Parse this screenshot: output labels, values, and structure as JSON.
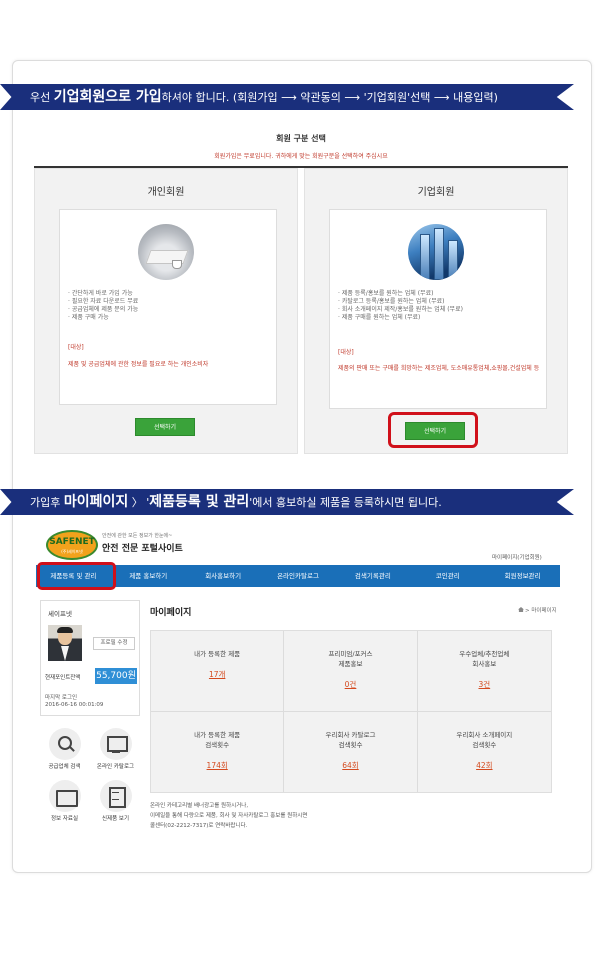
{
  "banner1": {
    "prefix": "우선 ",
    "bold": "기업회원으로 가입",
    "suffix": "하셔야 합니다. (회원가입 ⟶ 약관동의 ⟶ '기업회원'선택 ⟶ 내용입력)"
  },
  "selection": {
    "title": "회원 구분 선택",
    "subtitle": "회원가입은 무료입니다. 귀하에게 맞는 회원구분을 선택하여 주십시요"
  },
  "personal": {
    "title": "개인회원",
    "features": [
      "· 간단하게 바로 가입 가능",
      "· 필요한 자료 다운로드 무료",
      "· 공급업체에 제품 문의 가능",
      "· 제품 구매 가능"
    ],
    "target_label": "[대상]",
    "target_text": "제품 및 공급업체에 관한 정보를 필요로 하는 개인소비자",
    "button": "선택하기"
  },
  "corporate": {
    "title": "기업회원",
    "features": [
      "· 제품 등록/홍보를 원하는 업체 (무료)",
      "· 카탈로그 등록/홍보를 원하는 업체 (무료)",
      "· 회사 소개페이지 제작/홍보를 원하는 업체 (무료)",
      "· 제품 구매를 원하는 업체 (무료)"
    ],
    "target_label": "[대상]",
    "target_text": "제품의 판매 또는 구매를 희망하는 제조업체, 도소매유통업체,쇼핑몰,건설업체 등",
    "button": "선택하기"
  },
  "banner2": {
    "prefix": "가입후 ",
    "bold1": "마이페이지",
    "mid": " 〉 '",
    "bold2": "제품등록 및 관리",
    "suffix": "'에서 홍보하실 제품을 등록하시면 됩니다."
  },
  "logo": {
    "name": "SAFENET",
    "sub": "(주)세이프넷"
  },
  "header": {
    "tagline": "안전에 관한 모든 정보가 한눈에~",
    "portal": "안전 전문 포털사이트",
    "mypage_link": "마이페이지(기업회원)"
  },
  "nav": [
    "제품등록 및 관리",
    "제품 홍보하기",
    "회사홍보하기",
    "온라인카탈로그",
    "검색기록관리",
    "코인관리",
    "회원정보관리"
  ],
  "profile": {
    "name": "세이프넷",
    "edit": "프로필 수정",
    "points_label": "현재포인트잔액",
    "points": "55,700원",
    "last_login_label": "마지막 로그인",
    "last_login": "2016-06-16 00:01:09"
  },
  "quick_menu": [
    {
      "label": "공급업체 검색",
      "icon": "search-icon"
    },
    {
      "label": "온라인 카탈로그",
      "icon": "monitor-icon"
    },
    {
      "label": "정보 자료실",
      "icon": "folder-icon"
    },
    {
      "label": "신제품 보기",
      "icon": "document-icon"
    }
  ],
  "main": {
    "title": "마이페이지",
    "breadcrumb": "> 마이페이지"
  },
  "stats": [
    {
      "line1": "내가 등록한 제품",
      "line2": "",
      "value": "17개"
    },
    {
      "line1": "프리미엄/포커스",
      "line2": "제품홍보",
      "value": "0건"
    },
    {
      "line1": "우수업체/추천업체",
      "line2": "회사홍보",
      "value": "3건"
    },
    {
      "line1": "내가 등록한 제품",
      "line2": "검색횟수",
      "value": "174회"
    },
    {
      "line1": "우리회사 카탈로그",
      "line2": "검색횟수",
      "value": "64회"
    },
    {
      "line1": "우리회사 소개페이지",
      "line2": "검색횟수",
      "value": "42회"
    }
  ],
  "footnotes": [
    "온라인 카테고리별 배너광고를 원하시거나,",
    "이메일을 통해 다량으로 제품, 회사 및 자사카탈로그 홍보를 원하시면",
    "콜센터(02-2212-7317)로 연락바랍니다."
  ],
  "colors": {
    "banner": "#1a2f7c",
    "nav": "#1a6fb8",
    "green_button": "#3aa33a",
    "highlight_ring": "#d0101a",
    "value_text": "#d44a1f"
  }
}
